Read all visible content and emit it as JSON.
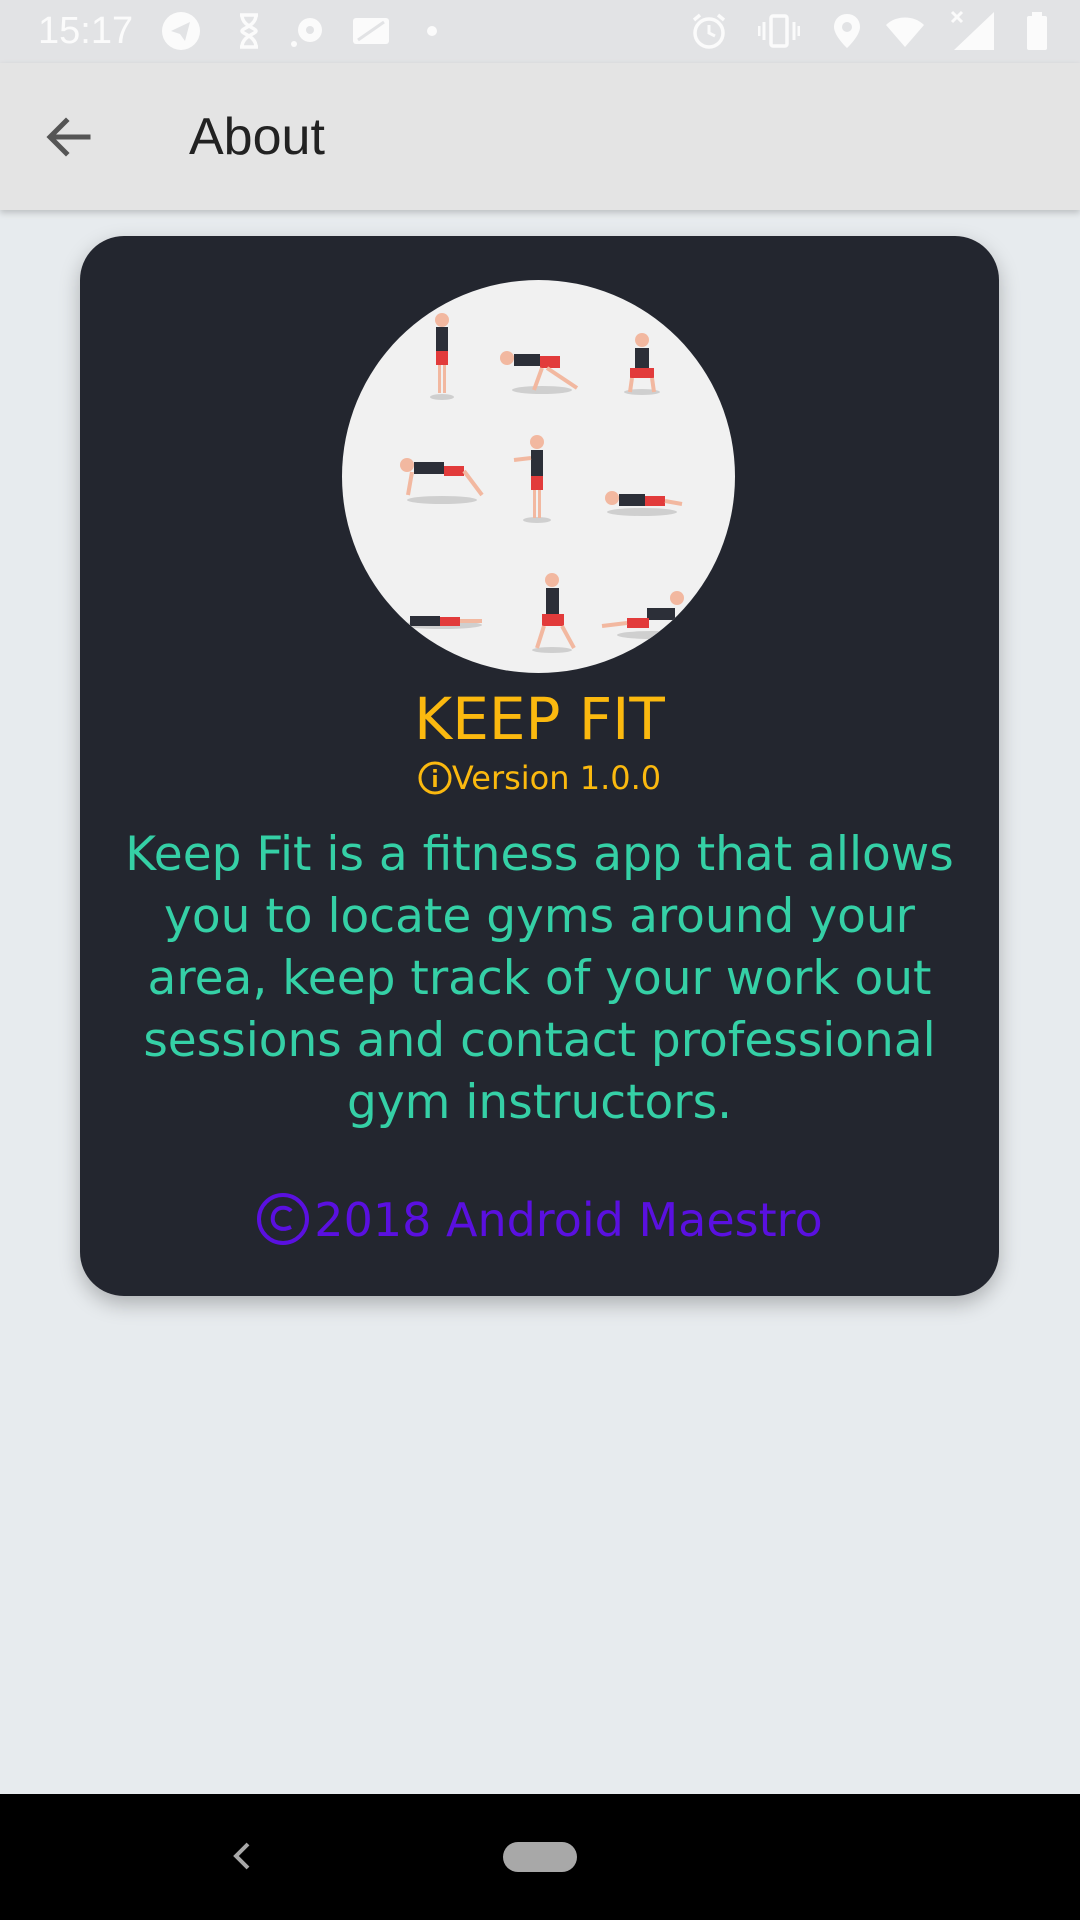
{
  "status_bar": {
    "time": "15:17",
    "left_icons": [
      "telegram-icon",
      "hourglass-icon",
      "cast-icon",
      "screen-icon",
      "dot-icon"
    ],
    "right_icons": [
      "alarm-icon",
      "vibrate-icon",
      "location-icon",
      "wifi-icon",
      "signal-icon",
      "battery-icon"
    ]
  },
  "app_bar": {
    "title": "About",
    "back_icon": "arrow-back-icon"
  },
  "card": {
    "app_name": "KEEP FIT",
    "version": "Version 1.0.0",
    "description": "Keep Fit is a fitness app that allows you to locate gyms around your area, keep track of your work out sessions and contact professional gym instructors.",
    "copyright": "2018 Android Maestro"
  },
  "colors": {
    "card_background": "#23262f",
    "app_name": "#fbb90f",
    "description": "#35d0a6",
    "copyright": "#5a10e0",
    "page_background": "#e7ebee"
  },
  "nav_bar": {
    "icons": [
      "nav-back-icon",
      "nav-home-pill"
    ]
  }
}
